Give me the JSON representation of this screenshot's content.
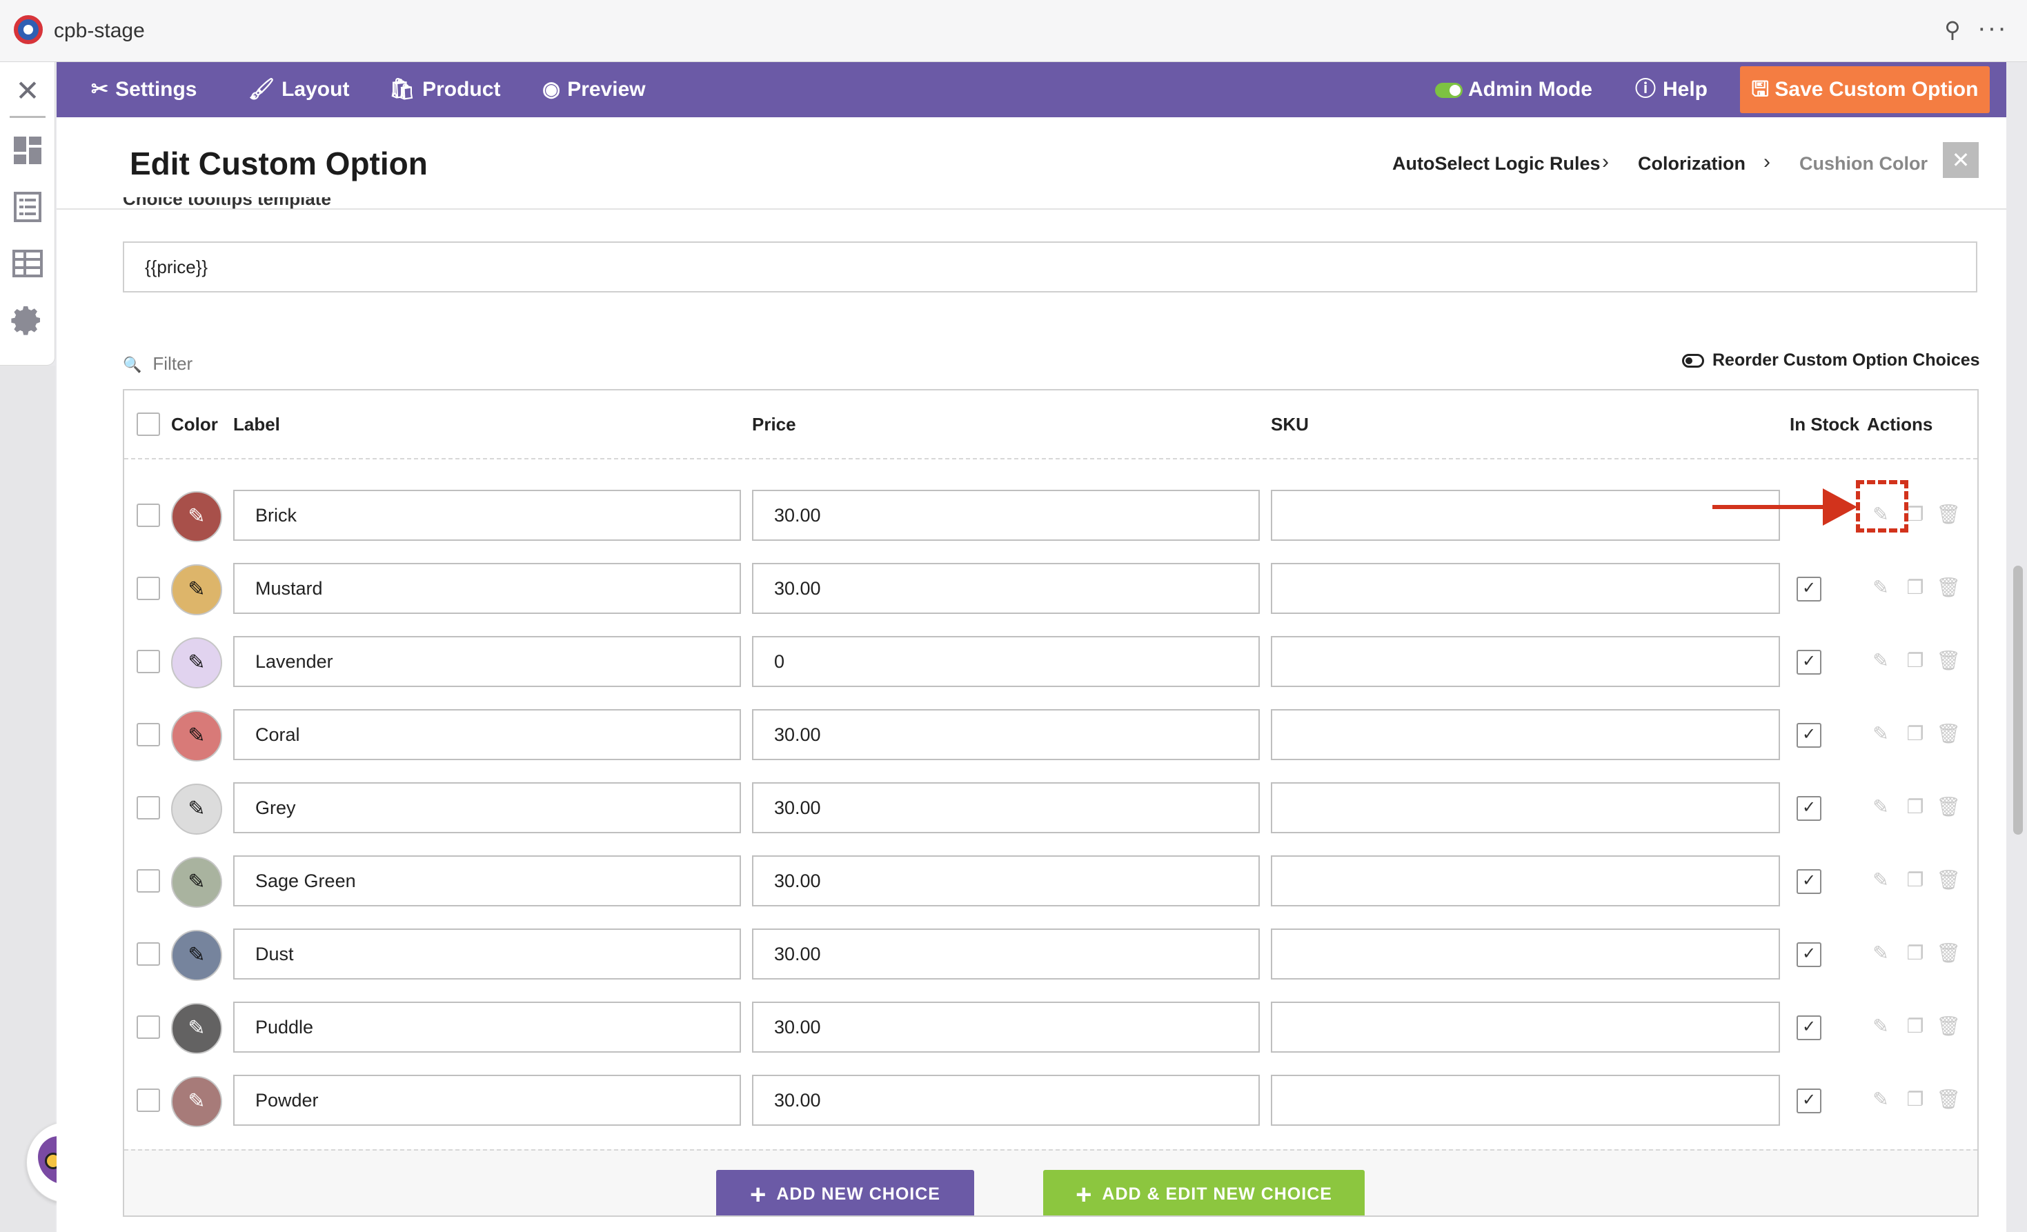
{
  "window": {
    "title": "cpb-stage"
  },
  "nav": {
    "settings": "Settings",
    "layout": "Layout",
    "product": "Product",
    "preview": "Preview",
    "admin_mode": "Admin Mode",
    "help": "Help",
    "save": "Save Custom Option"
  },
  "header": {
    "title": "Edit Custom Option",
    "breadcrumb": [
      "AutoSelect Logic Rules",
      "Colorization",
      "Cushion Color"
    ]
  },
  "tooltip_field": {
    "label": "Choice tooltips template",
    "value": "{{price}}"
  },
  "filter": {
    "placeholder": "Filter"
  },
  "reorder_label": "Reorder Custom Option Choices",
  "table": {
    "columns": {
      "color": "Color",
      "label": "Label",
      "price": "Price",
      "sku": "SKU",
      "in_stock": "In Stock",
      "actions": "Actions"
    },
    "rows": [
      {
        "label": "Brick",
        "price": "30.00",
        "sku": "",
        "color": "#a8504a",
        "in_stock": false
      },
      {
        "label": "Mustard",
        "price": "30.00",
        "sku": "",
        "color": "#ddb56a",
        "in_stock": true
      },
      {
        "label": "Lavender",
        "price": "0",
        "sku": "",
        "color": "#e1d3ef",
        "in_stock": true
      },
      {
        "label": "Coral",
        "price": "30.00",
        "sku": "",
        "color": "#d87a78",
        "in_stock": true
      },
      {
        "label": "Grey",
        "price": "30.00",
        "sku": "",
        "color": "#dcdcdc",
        "in_stock": true
      },
      {
        "label": "Sage Green",
        "price": "30.00",
        "sku": "",
        "color": "#a9b39f",
        "in_stock": true
      },
      {
        "label": "Dust",
        "price": "30.00",
        "sku": "",
        "color": "#76849d",
        "in_stock": true
      },
      {
        "label": "Puddle",
        "price": "30.00",
        "sku": "",
        "color": "#636262",
        "in_stock": true
      },
      {
        "label": "Powder",
        "price": "30.00",
        "sku": "",
        "color": "#a77b79",
        "in_stock": true
      }
    ]
  },
  "buttons": {
    "add": "ADD NEW CHOICE",
    "add_edit": "ADD & EDIT NEW CHOICE"
  },
  "colors": {
    "nav": "#6b5aa6",
    "save": "#f47d42",
    "add_edit": "#8cc63f",
    "annotation": "#d2331c"
  }
}
